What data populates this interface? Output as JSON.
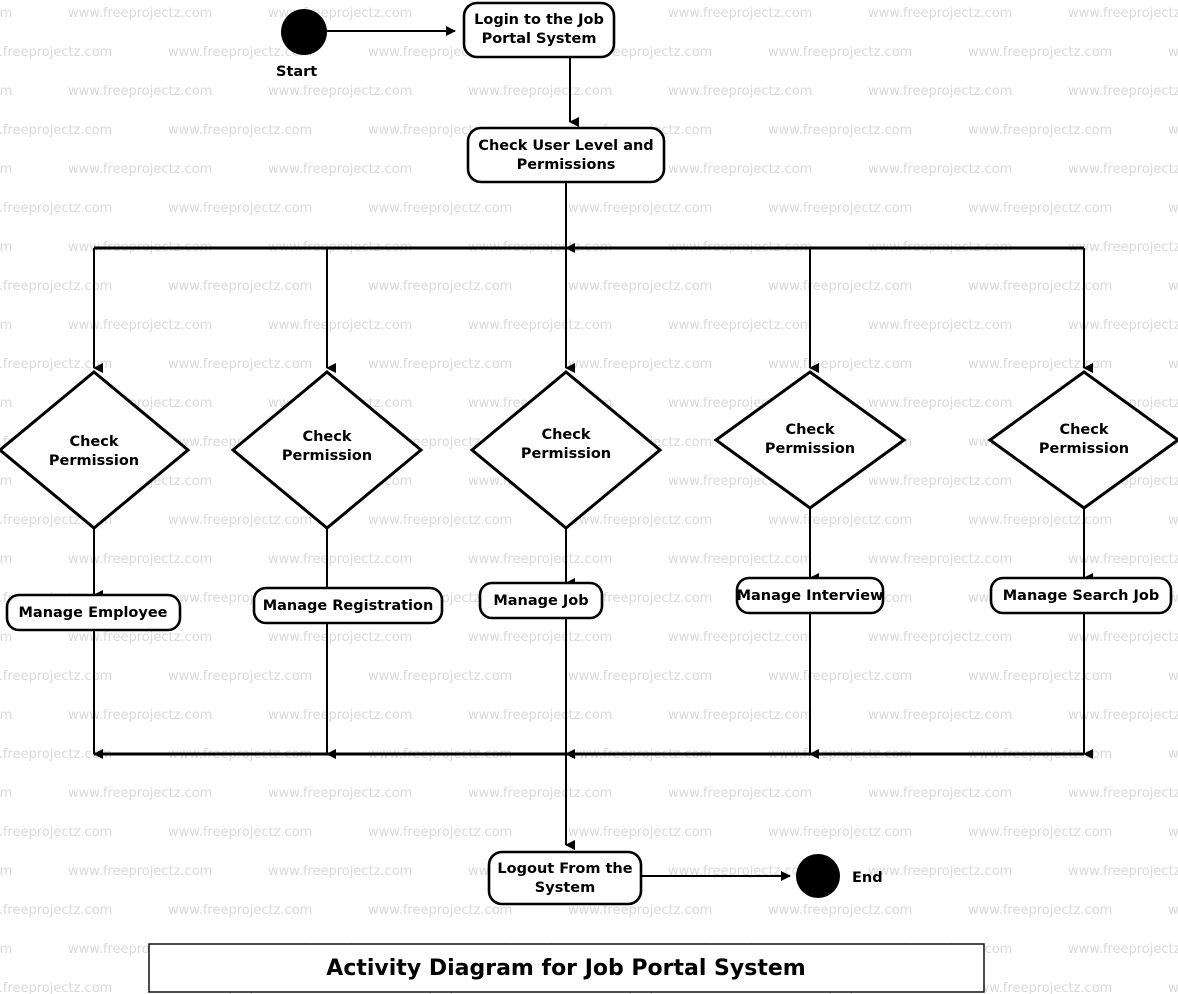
{
  "diagram": {
    "caption": "Activity Diagram for Job Portal System",
    "start_label": "Start",
    "end_label": "End",
    "initial_activity": {
      "line1": "Login to the Job",
      "line2": "Portal System"
    },
    "check_activity": {
      "line1": "Check User Level and",
      "line2": "Permissions"
    },
    "final_activity": {
      "line1": "Logout From the",
      "line2": "System"
    },
    "decisions": [
      {
        "line1": "Check",
        "line2": "Permission"
      },
      {
        "line1": "Check",
        "line2": "Permission"
      },
      {
        "line1": "Check",
        "line2": "Permission"
      },
      {
        "line1": "Check",
        "line2": "Permission"
      },
      {
        "line1": "Check",
        "line2": "Permission"
      }
    ],
    "activities": [
      {
        "label": "Manage Employee"
      },
      {
        "label": "Manage Registration"
      },
      {
        "label": "Manage Job"
      },
      {
        "label": "Manage Interview"
      },
      {
        "label": "Manage Search Job"
      }
    ],
    "watermark_text": "www.freeprojectz.com",
    "colors": {
      "stroke": "#000000",
      "fill": "#ffffff",
      "watermark": "#d9d9db"
    }
  }
}
